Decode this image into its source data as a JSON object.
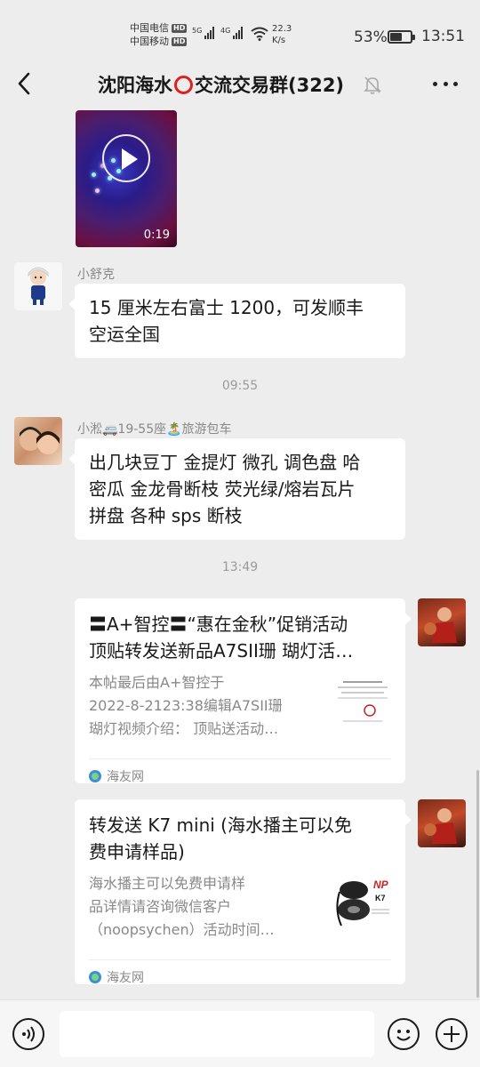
{
  "status_bar": {
    "carrier_1": "中国电信",
    "carrier_2": "中国移动",
    "hd_badge": "HD",
    "network_1": "5G",
    "network_2": "4G",
    "speed_value": "22.3",
    "speed_unit": "K/s",
    "battery_percent": "53%",
    "battery_level": 0.53,
    "time": "13:51"
  },
  "header": {
    "title_prefix": "沈阳海水",
    "title_suffix": "交流交易群(322)",
    "icons": {
      "back": "chevron-left-icon",
      "mute": "bell-off-icon",
      "more": "more-dots-icon"
    }
  },
  "messages": {
    "video": {
      "duration": "0:19"
    },
    "msg1": {
      "sender": "小舒克",
      "text_line1": "15 厘米左右富士 1200，可发顺丰",
      "text_line2": "空运全国"
    },
    "time1": "09:55",
    "msg2": {
      "sender": "小淞🚐19-55座🏝️旅游包车",
      "text_line1": "出几块豆丁 金提灯 微孔 调色盘 哈",
      "text_line2": "密瓜 金龙骨断枝 荧光绿/熔岩瓦片",
      "text_line3": "拼盘 各种 sps 断枝"
    },
    "time2": "13:49",
    "card1": {
      "title_line1": "〓A+智控〓“惠在金秋”促销活动",
      "title_line2": "顶贴转发送新品A7SII珊 瑚灯活…",
      "desc_line1": "本帖最后由A+智控于",
      "desc_line2": "2022-8-2123:38编辑A7SII珊",
      "desc_line3": "瑚灯视频介绍：  顶贴送活动…",
      "source": "海友网"
    },
    "card2": {
      "title_line1": "转发送 K7 mini (海水播主可以免",
      "title_line2": "费申请样品)",
      "desc_line1": "海水播主可以免费申请样",
      "desc_line2": "品详情请咨询微信客户",
      "desc_line3": "（noopsychen）活动时间…",
      "source": "海友网",
      "thumb_brand": "NP",
      "thumb_model": "K7"
    }
  },
  "input_bar": {
    "icons": {
      "voice": "voice-icon",
      "emoji": "emoji-icon",
      "plus": "plus-icon"
    }
  },
  "colors": {
    "background": "#ededed",
    "bubble": "#ffffff",
    "accent_red": "#e02020"
  }
}
